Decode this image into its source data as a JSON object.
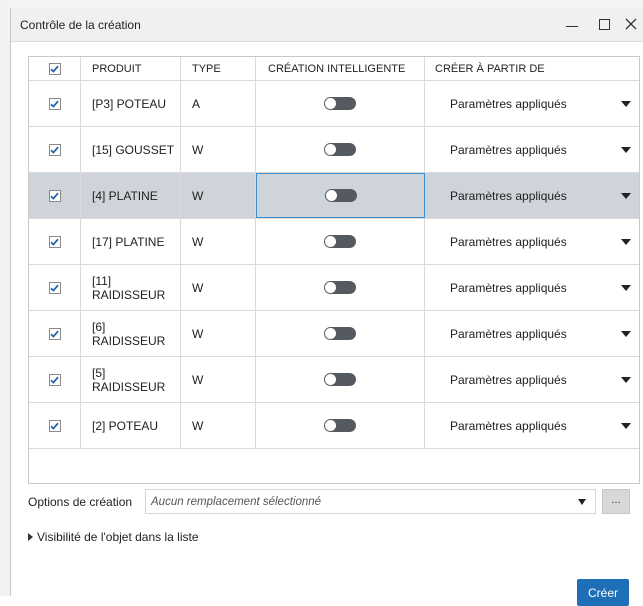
{
  "window": {
    "title": "Contrôle de la création"
  },
  "table": {
    "headers": {
      "product": "PRODUIT",
      "type": "TYPE",
      "smart": "CRÉATION INTELLIGENTE",
      "from": "CRÉER À PARTIR DE"
    },
    "rows": [
      {
        "product": "[P3] POTEAU",
        "type": "A",
        "from": "Paramètres appliqués"
      },
      {
        "product": "[15] GOUSSET",
        "type": "W",
        "from": "Paramètres appliqués"
      },
      {
        "product": "[4] PLATINE",
        "type": "W",
        "from": "Paramètres appliqués"
      },
      {
        "product": "[17] PLATINE",
        "type": "W",
        "from": "Paramètres appliqués"
      },
      {
        "product": "[11] RAIDISSEUR",
        "type": "W",
        "from": "Paramètres appliqués"
      },
      {
        "product": "[6] RAIDISSEUR",
        "type": "W",
        "from": "Paramètres appliqués"
      },
      {
        "product": "[5] RAIDISSEUR",
        "type": "W",
        "from": "Paramètres appliqués"
      },
      {
        "product": "[2] POTEAU",
        "type": "W",
        "from": "Paramètres appliqués"
      }
    ]
  },
  "options": {
    "label": "Options de création",
    "placeholder": "Aucun remplacement sélectionné",
    "more": "..."
  },
  "visibility": {
    "label": "Visibilité de l'objet dans la liste"
  },
  "actions": {
    "create": "Créer"
  },
  "colors": {
    "accent": "#1e6fb8",
    "check": "#1a5fa8",
    "selected_row": "#cfd4db",
    "toggle_off": "#555a60"
  }
}
